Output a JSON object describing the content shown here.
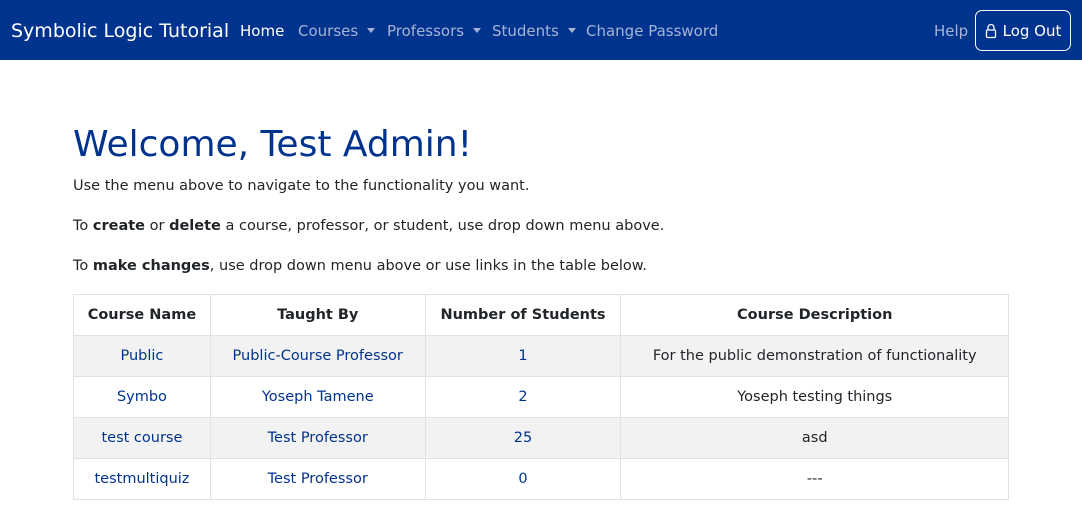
{
  "navbar": {
    "brand": "Symbolic Logic Tutorial",
    "items": {
      "home": "Home",
      "courses": "Courses",
      "professors": "Professors",
      "students": "Students",
      "change_password": "Change Password",
      "help": "Help"
    },
    "logout_label": "Log Out"
  },
  "main": {
    "heading": "Welcome, Test Admin!",
    "p1": "Use the menu above to navigate to the functionality you want.",
    "p2": {
      "t1": "To ",
      "b1": "create",
      "t2": " or ",
      "b2": "delete",
      "t3": " a course, professor, or student, use drop down menu above."
    },
    "p3": {
      "t1": "To ",
      "b1": "make changes",
      "t2": ", use drop down menu above or use links in the table below."
    }
  },
  "table": {
    "headers": [
      "Course Name",
      "Taught By",
      "Number of Students",
      "Course Description"
    ],
    "rows": [
      [
        "Public",
        "Public-Course Professor",
        "1",
        "For the public demonstration of functionality"
      ],
      [
        "Symbo",
        "Yoseph Tamene",
        "2",
        "Yoseph testing things"
      ],
      [
        "test course",
        "Test Professor",
        "25",
        "asd"
      ],
      [
        "testmultiquiz",
        "Test Professor",
        "0",
        "---"
      ]
    ]
  },
  "colors": {
    "navbar_bg": "#00338d",
    "link": "#00338d",
    "heading": "#00338d",
    "stripe": "#f2f2f2"
  }
}
